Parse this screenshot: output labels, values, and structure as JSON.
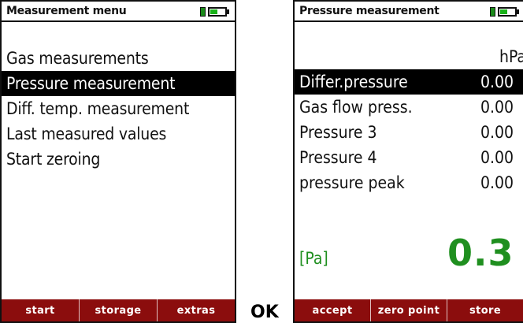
{
  "left_screen": {
    "title": "Measurement menu",
    "battery_icon": "battery-icon",
    "menu_items": [
      {
        "label": "Gas measurements",
        "selected": false
      },
      {
        "label": "Pressure measurement",
        "selected": true
      },
      {
        "label": "Diff. temp. measurement",
        "selected": false
      },
      {
        "label": "Last measured values",
        "selected": false
      },
      {
        "label": "Start zeroing",
        "selected": false
      }
    ],
    "softkeys": [
      "start",
      "storage",
      "extras"
    ]
  },
  "ok_label": "OK",
  "right_screen": {
    "title": "Pressure measurement",
    "battery_icon": "battery-icon",
    "unit": "hPa",
    "readings": [
      {
        "label": "Differ.pressure",
        "value": "0.00",
        "selected": true
      },
      {
        "label": "Gas flow press.",
        "value": "0.00",
        "selected": false
      },
      {
        "label": "Pressure 3",
        "value": "0.00",
        "selected": false
      },
      {
        "label": "Pressure 4",
        "value": "0.00",
        "selected": false
      },
      {
        "label": "pressure peak",
        "value": "0.00",
        "selected": false
      }
    ],
    "big_unit_label": "[Pa]",
    "big_value": "0.3",
    "softkeys": [
      "accept",
      "zero point",
      "store"
    ]
  },
  "colors": {
    "softkey_bg": "#8b0d0d",
    "highlight_bg": "#000000",
    "value_green": "#1f8f1f",
    "battery_green": "#19b219"
  }
}
